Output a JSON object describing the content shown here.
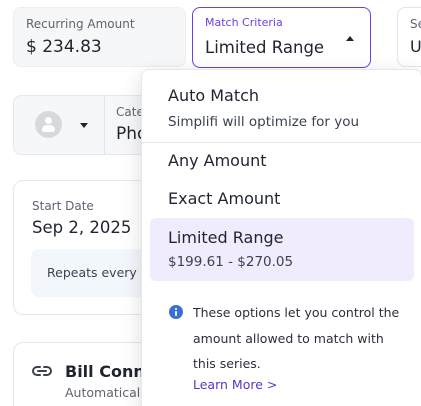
{
  "recurring_amount": {
    "label": "Recurring Amount",
    "value": "$ 234.83"
  },
  "match_criteria": {
    "label": "Match Criteria",
    "value": "Limited Range"
  },
  "series_field": {
    "label": "Se",
    "value": "U"
  },
  "category_field": {
    "label": "Cate",
    "value": "Pho"
  },
  "start_date": {
    "label": "Start Date",
    "value": "Sep 2, 2025",
    "repeat_text": "Repeats every m"
  },
  "bill_connect": {
    "title": "Bill Conne",
    "subtitle": "Automatically"
  },
  "menu": {
    "options": [
      {
        "label": "Auto Match",
        "description": "Simplifi will optimize for you"
      },
      {
        "label": "Any Amount"
      },
      {
        "label": "Exact Amount"
      },
      {
        "label": "Limited Range",
        "description": "$199.61 - $270.05",
        "selected": true
      }
    ],
    "info_text": "These options let you control the amount allowed to match with this series.",
    "learn_more": "Learn More >"
  },
  "colors": {
    "accent": "#6b3ee6",
    "selected_bg": "#f0ecfd",
    "info_icon": "#3b6fd8",
    "link": "#5a34c9"
  },
  "icons": [
    "person-avatar-icon",
    "chevron-down-icon",
    "caret-up-icon",
    "link-icon",
    "info-icon"
  ]
}
